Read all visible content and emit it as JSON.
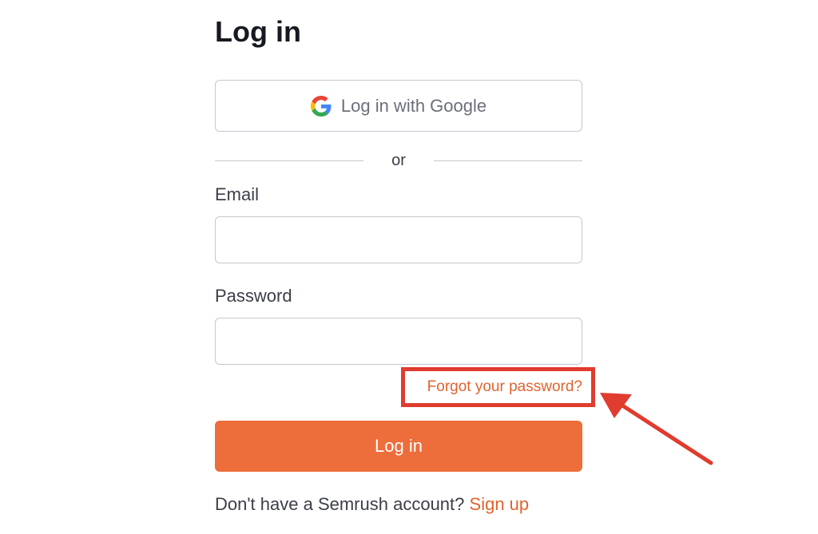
{
  "form": {
    "title": "Log in",
    "google_button_label": "Log in with Google",
    "divider_text": "or",
    "email_label": "Email",
    "email_value": "",
    "password_label": "Password",
    "password_value": "",
    "forgot_password_link": "Forgot your password?",
    "login_button_label": "Log in",
    "signup_prompt": "Don't have a Semrush account?",
    "signup_link": "Sign up"
  },
  "icons": {
    "google": "google-logo-icon"
  },
  "colors": {
    "accent": "#ed6d3b",
    "link": "#e0632f",
    "annotation": "#e03c2f",
    "border": "#c4c7cf",
    "text": "#171a22"
  }
}
